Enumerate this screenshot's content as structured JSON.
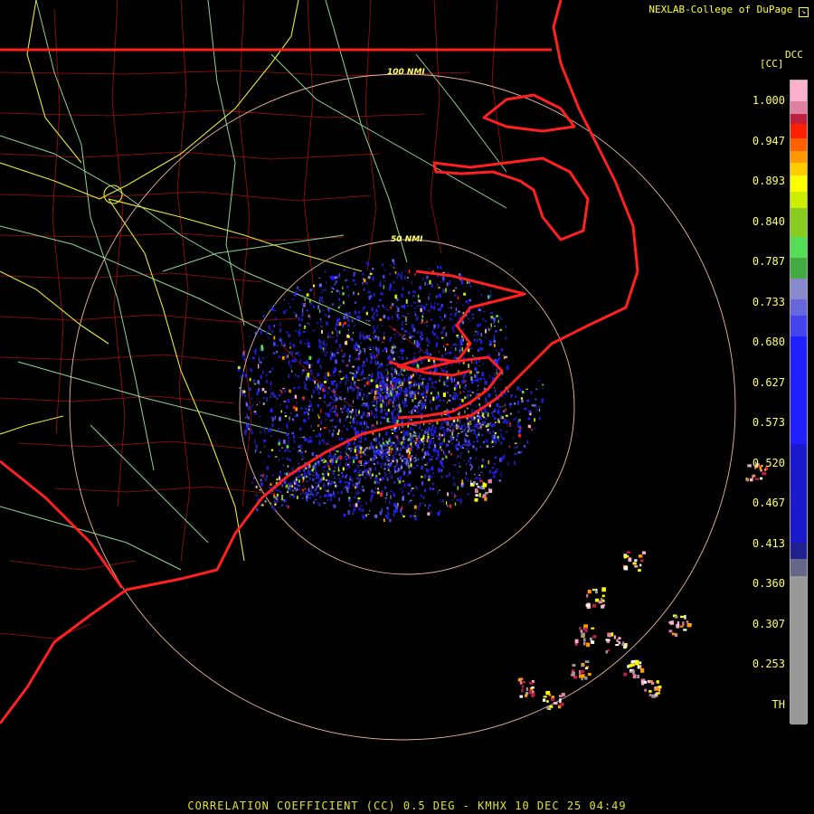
{
  "header": {
    "credit": "NEXLAB-College of DuPage",
    "credit_icon": "arrow-box-icon"
  },
  "footer": {
    "caption": "CORRELATION COEFFICIENT (CC) 0.5 DEG - KMHX 10 DEC 25 04:49"
  },
  "range_rings": {
    "outer_label": "100 NMI",
    "inner_label": "50 NMI"
  },
  "legend": {
    "product_code": "DCC",
    "unit": "[CC]",
    "labels": [
      "1.000",
      "0.947",
      "0.893",
      "0.840",
      "0.787",
      "0.733",
      "0.680",
      "0.627",
      "0.573",
      "0.520",
      "0.467",
      "0.413",
      "0.360",
      "0.307",
      "0.253",
      "TH"
    ],
    "bands": [
      {
        "from": 1.0,
        "color": "#ffb0cc"
      },
      {
        "from": 0.975,
        "color": "#e080a0"
      },
      {
        "from": 0.96,
        "color": "#c02040"
      },
      {
        "from": 0.947,
        "color": "#ff2000"
      },
      {
        "from": 0.93,
        "color": "#ff6000"
      },
      {
        "from": 0.915,
        "color": "#ff9900"
      },
      {
        "from": 0.9,
        "color": "#ffcc00"
      },
      {
        "from": 0.885,
        "color": "#ffff00"
      },
      {
        "from": 0.865,
        "color": "#ccee00"
      },
      {
        "from": 0.845,
        "color": "#88cc22"
      },
      {
        "from": 0.81,
        "color": "#55dd55"
      },
      {
        "from": 0.785,
        "color": "#44aa44"
      },
      {
        "from": 0.76,
        "color": "#8888cc"
      },
      {
        "from": 0.735,
        "color": "#6666dd"
      },
      {
        "from": 0.715,
        "color": "#4444ee"
      },
      {
        "from": 0.69,
        "color": "#2020ff"
      },
      {
        "from": 0.56,
        "color": "#1a1acc"
      },
      {
        "from": 0.44,
        "color": "#202090"
      },
      {
        "from": 0.42,
        "color": "#666688"
      },
      {
        "from": 0.4,
        "color": "#999999"
      },
      {
        "from": 0.22,
        "color": "#111111"
      }
    ]
  },
  "colors": {
    "state_border": "#ff2020",
    "county_line": "#aa1010",
    "highway_primary": "#e8e83a",
    "highway_secondary": "#90d890",
    "range_ring": "#e8b8a0"
  }
}
